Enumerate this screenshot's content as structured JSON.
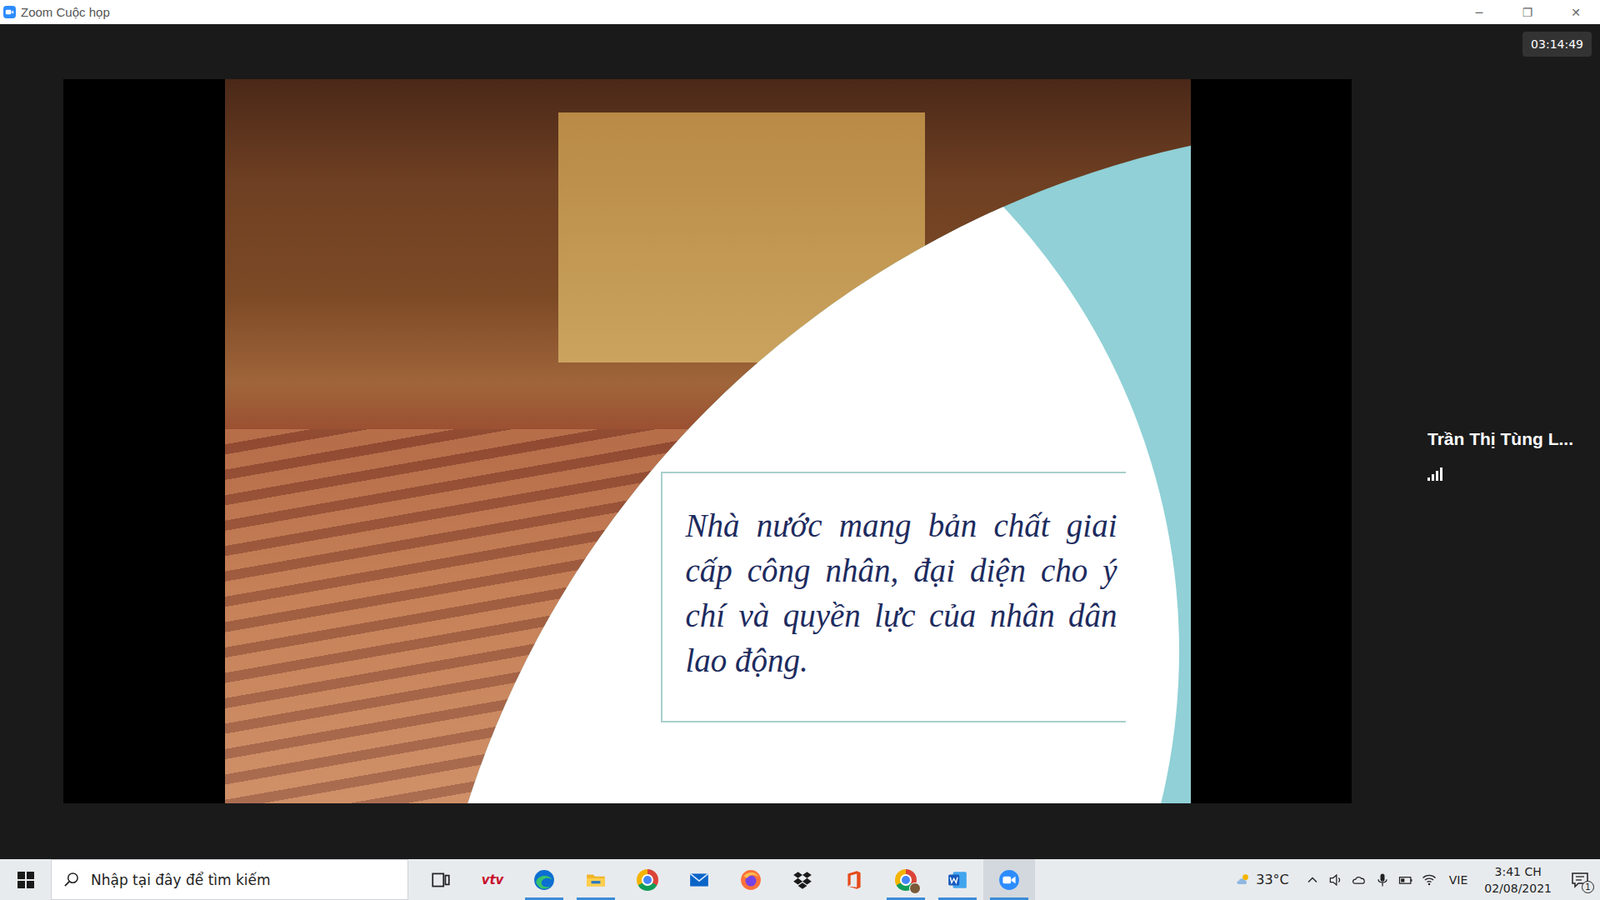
{
  "window": {
    "title": "Zoom Cuộc họp",
    "controls": [
      "─",
      "❐",
      "✕"
    ]
  },
  "meeting": {
    "timer": "03:14:49"
  },
  "slide": {
    "text": "Nhà nước mang bản chất giai cấp công nhân, đại diện cho ý chí và quyền lực của nhân dân lao động."
  },
  "participant": {
    "name": "Trần Thị Tùng L...",
    "signal_level": 1
  },
  "taskbar": {
    "search": {
      "placeholder": "Nhập tại đây để tìm kiếm"
    },
    "apps": [
      {
        "kind": "taskview",
        "running": false,
        "selected": false
      },
      {
        "kind": "vtv",
        "text": "vtv",
        "running": false,
        "selected": false
      },
      {
        "kind": "edge",
        "running": true,
        "selected": false
      },
      {
        "kind": "explorer",
        "running": true,
        "selected": false
      },
      {
        "kind": "chrome",
        "running": false,
        "selected": false
      },
      {
        "kind": "mail",
        "running": false,
        "selected": false
      },
      {
        "kind": "firefox",
        "running": false,
        "selected": false
      },
      {
        "kind": "dropbox",
        "running": false,
        "selected": false
      },
      {
        "kind": "office",
        "running": false,
        "selected": false
      },
      {
        "kind": "chrome-profile",
        "running": true,
        "selected": false
      },
      {
        "kind": "word",
        "running": true,
        "selected": false
      },
      {
        "kind": "zoom",
        "running": true,
        "selected": true
      }
    ],
    "tray": {
      "weather": "33°C",
      "language": "VIE",
      "time": "3:41 CH",
      "date": "02/08/2021",
      "notifications": "1"
    }
  }
}
